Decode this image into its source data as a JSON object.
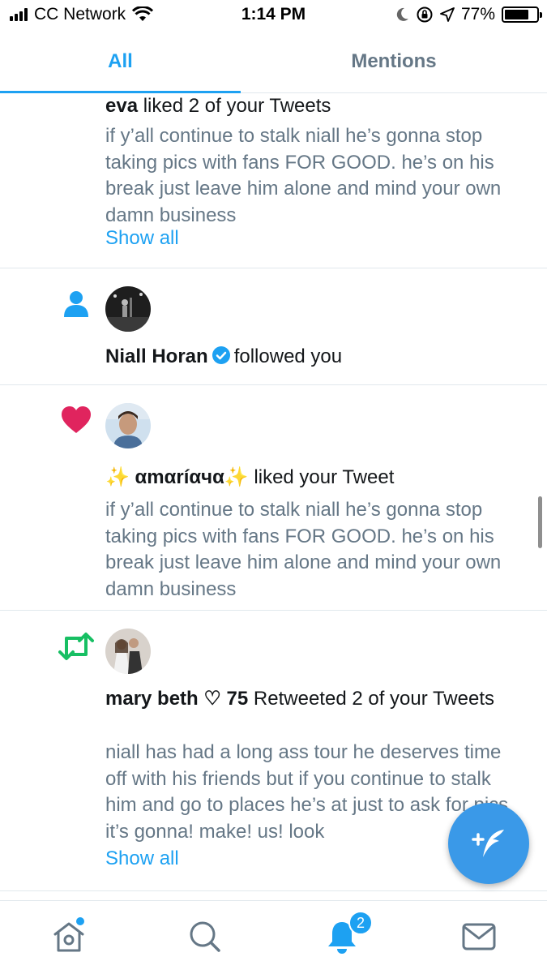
{
  "status_bar": {
    "carrier": "CC Network",
    "time": "1:14 PM",
    "battery": "77%",
    "battery_level": 0.77
  },
  "tabs": [
    {
      "label": "All",
      "active": true
    },
    {
      "label": "Mentions",
      "active": false
    }
  ],
  "notifications": [
    {
      "type": "like",
      "name": "eva",
      "action": "liked 2 of your Tweets",
      "tweet": "if y’all continue to stalk niall he’s gonna stop taking pics with fans FOR GOOD. he’s on his break just leave him alone and mind your own damn business",
      "show_all": "Show all"
    },
    {
      "type": "follow",
      "name": "Niall Horan",
      "verified": true,
      "action": "followed you"
    },
    {
      "type": "like",
      "name": "✨ αmαríαчα✨",
      "action": "liked your Tweet",
      "tweet": "if y’all continue to stalk niall he’s gonna stop taking pics with fans FOR GOOD. he’s on his break just leave him alone and mind your own damn business"
    },
    {
      "type": "retweet",
      "name": "mary beth ♡ 75",
      "action": "Retweeted 2 of your Tweets",
      "tweet": "niall has had a long ass tour he deserves time off with his friends but if you continue to stalk him and go to places he’s at just to ask for pics it’s gonna! make! us! look",
      "show_all": "Show all"
    }
  ],
  "bottom_nav": {
    "notification_badge": "2",
    "icons": [
      "home-icon",
      "search-icon",
      "notifications-bell-icon",
      "messages-icon"
    ]
  },
  "colors": {
    "accent": "#1da1f2",
    "like": "#e0245e",
    "retweet": "#17bf63",
    "secondary_text": "#657786"
  }
}
